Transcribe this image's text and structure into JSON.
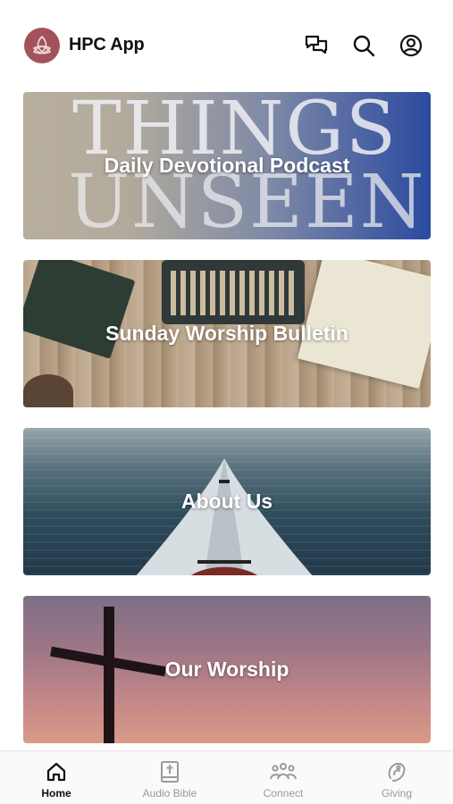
{
  "header": {
    "app_title": "HPC App",
    "logo_icon": "trinity-knot-icon",
    "icons": [
      "chat-icon",
      "search-icon",
      "account-icon"
    ]
  },
  "cards": [
    {
      "label": "Daily Devotional Podcast",
      "image_text_1": "THINGS",
      "image_text_2": "UNSEEN"
    },
    {
      "label": "Sunday Worship Bulletin"
    },
    {
      "label": "About Us"
    },
    {
      "label": "Our Worship"
    }
  ],
  "tabs": [
    {
      "label": "Home",
      "icon": "home-icon",
      "active": true
    },
    {
      "label": "Audio Bible",
      "icon": "bible-icon",
      "active": false
    },
    {
      "label": "Connect",
      "icon": "people-icon",
      "active": false
    },
    {
      "label": "Giving",
      "icon": "giving-icon",
      "active": false
    }
  ],
  "colors": {
    "brand": "#a2525a",
    "active_tab": "#111111",
    "inactive_tab": "#9a9a9a"
  }
}
